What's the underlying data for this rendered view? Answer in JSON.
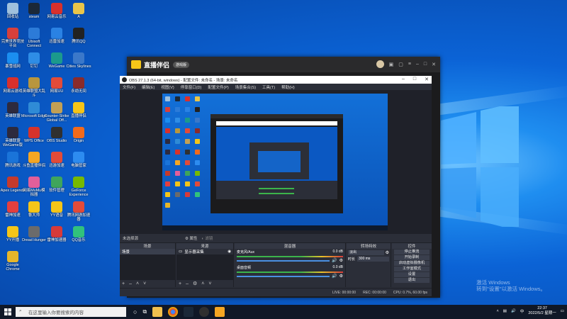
{
  "desktop": {
    "icons": [
      {
        "label": "回收站",
        "color": "#9fc0dd"
      },
      {
        "label": "steam",
        "color": "#1b2838"
      },
      {
        "label": "网易云音乐",
        "color": "#d9302c"
      },
      {
        "label": "A",
        "color": "#e8c54a"
      },
      {
        "label": "完美世界竞技平台",
        "color": "#d7403c"
      },
      {
        "label": "Ubisoft Connect",
        "color": "#2c7bd8"
      },
      {
        "label": "迅雷加速",
        "color": "#2a82e4"
      },
      {
        "label": "腾讯QQ",
        "color": "#222222"
      },
      {
        "label": "暴雪战网",
        "color": "#1b8ef0"
      },
      {
        "label": "钉钉",
        "color": "#2e8de6"
      },
      {
        "label": "WeGame",
        "color": "#1b9a8c"
      },
      {
        "label": "Cities Skylines",
        "color": "#3b78c9"
      },
      {
        "label": "网易云游戏",
        "color": "#d9302c"
      },
      {
        "label": "英雄联盟大乱斗",
        "color": "#b8963e"
      },
      {
        "label": "网易UU",
        "color": "#e24b39"
      },
      {
        "label": "永劫无间",
        "color": "#8a2b2b"
      },
      {
        "label": "英雄联盟",
        "color": "#2d2a3e"
      },
      {
        "label": "Microsoft Edge",
        "color": "#2f8bd6"
      },
      {
        "label": "Counter-Strike Global Off...",
        "color": "#c2a055"
      },
      {
        "label": "直播伴侣",
        "color": "#f5c518"
      },
      {
        "label": "英雄联盟WeGame版",
        "color": "#2d2a3e"
      },
      {
        "label": "WPS Office",
        "color": "#d6332b"
      },
      {
        "label": "OBS Studio",
        "color": "#303030"
      },
      {
        "label": "Origin",
        "color": "#f26a1b"
      },
      {
        "label": "腾讯游戏",
        "color": "#1a74d9"
      },
      {
        "label": "斗鱼直播伴侣",
        "color": "#f5a623"
      },
      {
        "label": "迅游加速",
        "color": "#e24b39"
      },
      {
        "label": "电脑管家",
        "color": "#2d8cf0"
      },
      {
        "label": "Apex Legends",
        "color": "#c53a2c"
      },
      {
        "label": "网易MuMu模拟器",
        "color": "#e25f9a"
      },
      {
        "label": "软件管理",
        "color": "#3fa55b"
      },
      {
        "label": "GeForce Experience",
        "color": "#76b900"
      },
      {
        "label": "雷神加速",
        "color": "#e43f3f"
      },
      {
        "label": "鲁大师",
        "color": "#f5c518"
      },
      {
        "label": "YY语音",
        "color": "#f5c518"
      },
      {
        "label": "腾讯网游加速器",
        "color": "#e24b39"
      },
      {
        "label": "YY开播",
        "color": "#f5c518"
      },
      {
        "label": "Dread Hunger",
        "color": "#6b6b6b"
      },
      {
        "label": "雷神加速器",
        "color": "#d63a3a"
      },
      {
        "label": "QQ音乐",
        "color": "#31c27c"
      },
      {
        "label": "Google Chrome",
        "color": "#e6b62a"
      }
    ],
    "watermark_line1": "激活 Windows",
    "watermark_line2": "转到\"设置\"以激活 Windows。"
  },
  "assistant": {
    "title": "直播伴侣",
    "badge": "游戏版"
  },
  "obs": {
    "title": "OBS 27.1.3 (64-bit, windows) - 配置文件: 未命名 - 场景: 未命名",
    "menu": [
      "文件(F)",
      "编辑(E)",
      "视图(V)",
      "停靠窗口(D)",
      "配置文件(P)",
      "场景集合(S)",
      "工具(T)",
      "帮助(H)"
    ],
    "no_source": "未选择源",
    "properties": "属性",
    "filters": "滤镜",
    "docks": {
      "scenes": "场景",
      "scene_item": "场景",
      "sources": "来源",
      "source_item": "显示器采集",
      "mixer": "混音器",
      "transitions": "转场特效",
      "controls": "控件"
    },
    "mixer_tracks": [
      {
        "name": "麦克风/Aux",
        "db": "0.0 dB"
      },
      {
        "name": "桌面音频",
        "db": "0.0 dB"
      }
    ],
    "transition": {
      "type": "淡出",
      "duration_label": "时长",
      "duration": "300 ms"
    },
    "controls": [
      "停止推流",
      "开始录制",
      "启动虚拟摄像机",
      "工作室模式",
      "设置",
      "退出"
    ],
    "status": {
      "live": "LIVE: 00:00:00",
      "rec": "REC: 00:00:00",
      "cpu": "CPU: 0.7%, 60.00 fps"
    }
  },
  "taskbar": {
    "search_placeholder": "在这里输入你要搜索的内容",
    "time": "22:37",
    "date": "2022/5/2 星期一",
    "ime": "中"
  }
}
